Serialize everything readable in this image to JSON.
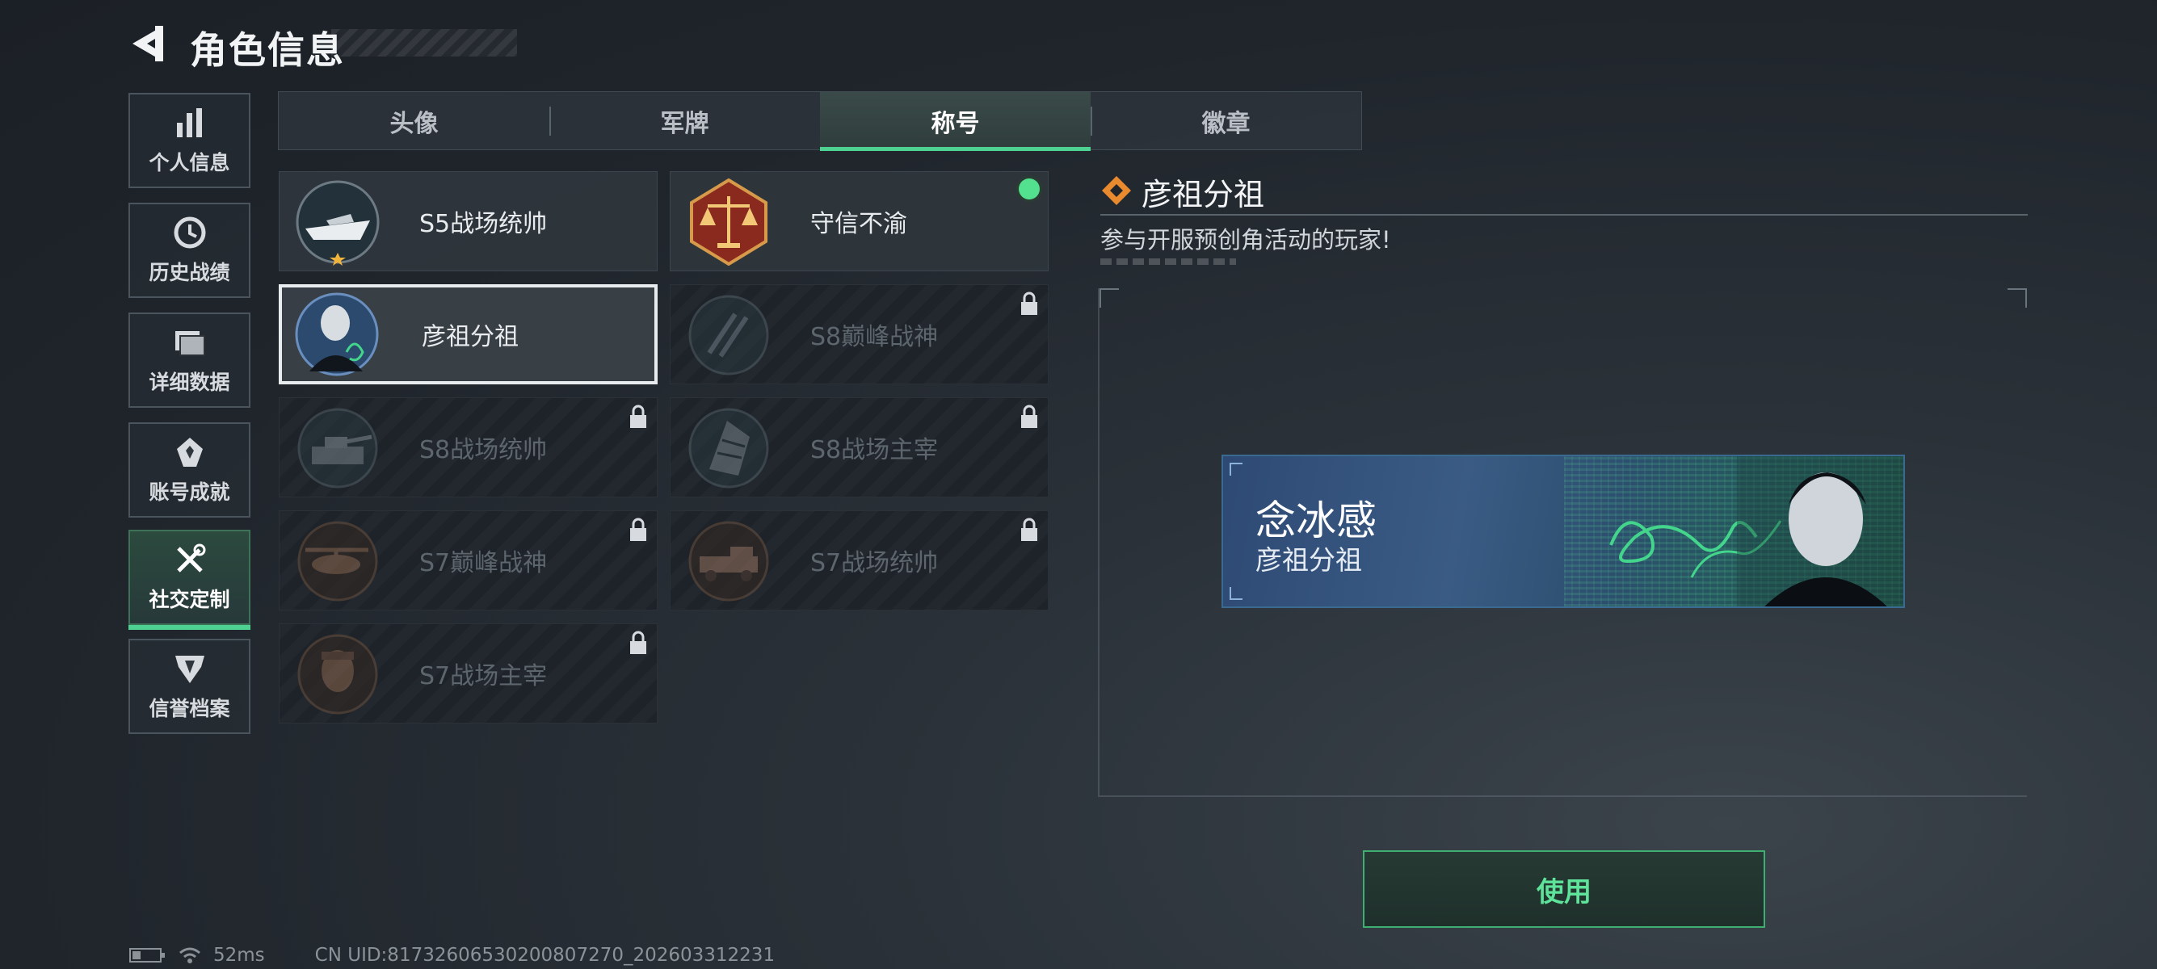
{
  "header": {
    "title": "角色信息",
    "back_icon": "back-arrow-icon"
  },
  "nav": {
    "items": [
      {
        "label": "个人信息",
        "icon": "bar-chart-icon",
        "active": false
      },
      {
        "label": "历史战绩",
        "icon": "clock-icon",
        "active": false
      },
      {
        "label": "详细数据",
        "icon": "folder-icon",
        "active": false
      },
      {
        "label": "账号成就",
        "icon": "medal-icon",
        "active": false
      },
      {
        "label": "社交定制",
        "icon": "tools-icon",
        "active": true
      },
      {
        "label": "信誉档案",
        "icon": "shield-icon",
        "active": false
      }
    ]
  },
  "tabs": [
    {
      "label": "头像",
      "active": false
    },
    {
      "label": "军牌",
      "active": false
    },
    {
      "label": "称号",
      "active": true
    },
    {
      "label": "徽章",
      "active": false
    }
  ],
  "titles": [
    {
      "name": "S5战场统帅",
      "emblem": "speedboat-emblem",
      "locked": false,
      "equipped": false,
      "selected": false
    },
    {
      "name": "守信不渝",
      "emblem": "scales-emblem",
      "locked": false,
      "equipped": true,
      "selected": false
    },
    {
      "name": "彦祖分祖",
      "emblem": "portrait-emblem",
      "locked": false,
      "equipped": false,
      "selected": true
    },
    {
      "name": "S8巅峰战神",
      "emblem": "claw-emblem",
      "locked": true,
      "equipped": false,
      "selected": false
    },
    {
      "name": "S8战场统帅",
      "emblem": "tank-emblem",
      "locked": true,
      "equipped": false,
      "selected": false
    },
    {
      "name": "S8战场主宰",
      "emblem": "tower-emblem",
      "locked": true,
      "equipped": false,
      "selected": false
    },
    {
      "name": "S7巅峰战神",
      "emblem": "heli-emblem",
      "locked": true,
      "equipped": false,
      "selected": false
    },
    {
      "name": "S7战场统帅",
      "emblem": "truck-emblem",
      "locked": true,
      "equipped": false,
      "selected": false
    },
    {
      "name": "S7战场主宰",
      "emblem": "soldier-emblem",
      "locked": true,
      "equipped": false,
      "selected": false
    }
  ],
  "detail": {
    "title": "彦祖分祖",
    "description": "参与开服预创角活动的玩家!",
    "banner": {
      "player_name": "念冰感",
      "title": "彦祖分祖"
    },
    "use_label": "使用"
  },
  "footer": {
    "latency": "52ms",
    "uid": "CN UID:81732606530200807270_202603312231"
  },
  "colors": {
    "accent": "#4ed291",
    "equipped_dot": "#53e08f",
    "button_text": "#5fe39b"
  }
}
